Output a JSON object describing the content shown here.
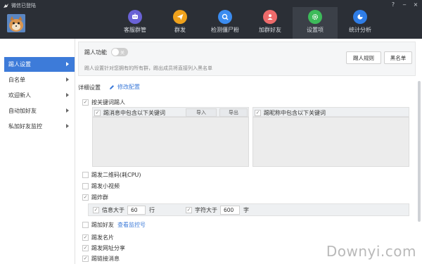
{
  "window": {
    "title": "微信已登陆",
    "controls": [
      "?",
      "‒",
      "×"
    ]
  },
  "nav": {
    "items": [
      {
        "label": "客服群管",
        "icon": "robot-icon",
        "color": "#6a62d6",
        "active": false
      },
      {
        "label": "群发",
        "icon": "send-icon",
        "color": "#f0a21c",
        "active": false
      },
      {
        "label": "检测僵尸粉",
        "icon": "detect-icon",
        "color": "#3b8cf0",
        "active": false
      },
      {
        "label": "加群好友",
        "icon": "add-friend-icon",
        "color": "#ee6b6b",
        "active": false
      },
      {
        "label": "设置项",
        "icon": "gear-icon",
        "color": "#3dbb5a",
        "active": true
      },
      {
        "label": "统计分析",
        "icon": "pie-chart-icon",
        "color": "#2f7de6",
        "active": false
      }
    ]
  },
  "sidebar": {
    "items": [
      {
        "label": "踢人设置",
        "active": true
      },
      {
        "label": "白名单",
        "active": false
      },
      {
        "label": "欢迎新人",
        "active": false
      },
      {
        "label": "自动加好友",
        "active": false
      },
      {
        "label": "私加好友监控",
        "active": false
      }
    ]
  },
  "kick": {
    "label": "踢人功能",
    "toggle_text": "关",
    "description": "踢人设置针对您拥有的所有群，踢出成员将直接列入黑名单",
    "rules_button": "踢人规则",
    "blacklist_button": "黑名单"
  },
  "detail": {
    "label": "详细设置",
    "edit_link": "修改配置",
    "by_keyword": "按关键词踢人",
    "msg_keyword": "踢消息中包含以下关键词",
    "import_btn": "导入",
    "export_btn": "导出",
    "nick_keyword": "踢昵称中包含以下关键词",
    "qr_code": "踢发二维码(耗CPU)",
    "short_video": "踢发小视频",
    "spam": "踢炸群",
    "info_gt": "信息大于",
    "info_value": "60",
    "info_unit": "行",
    "char_gt": "字符大于",
    "char_value": "600",
    "char_unit": "字",
    "add_friend": "踢加好友",
    "view_monitor": "查看监控号",
    "name_card": "踢发名片",
    "url_share": "踢发网址分享",
    "bottom_partial": "踢链接消息"
  },
  "watermark": "Downyi.com",
  "colors": {
    "accent": "#3d7bd9",
    "titlebar": "#2b2f36"
  }
}
